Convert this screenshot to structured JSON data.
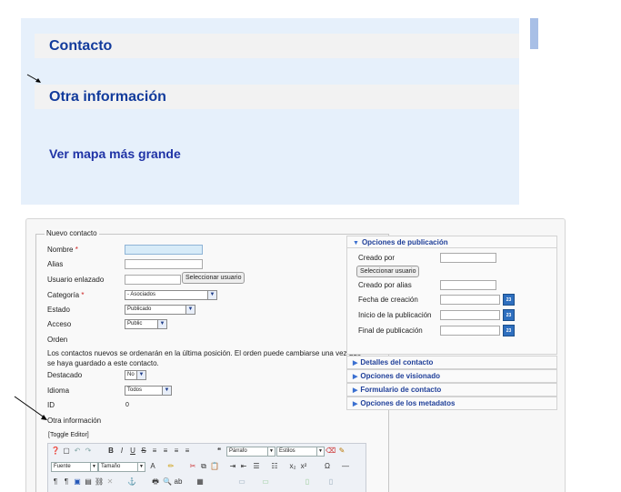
{
  "preview": {
    "contact_heading": "Contacto",
    "other_info_heading": "Otra información",
    "map_link": "Ver mapa más grande"
  },
  "form": {
    "legend": "Nuevo contacto",
    "required_mark": "*",
    "fields": {
      "nombre": "Nombre",
      "alias": "Alias",
      "usuario_enlazado": "Usuario enlazado",
      "seleccionar_usuario": "Seleccionar usuario",
      "categoria": "Categoría",
      "categoria_value": "- Asociados",
      "estado": "Estado",
      "estado_value": "Publicado",
      "acceso": "Acceso",
      "acceso_value": "Public",
      "orden": "Orden",
      "orden_note": "Los contactos nuevos se ordenarán en la última posición. El orden puede cambiarse una vez que se haya guardado a este contacto.",
      "destacado": "Destacado",
      "destacado_value": "No",
      "idioma": "Idioma",
      "idioma_value": "Todos",
      "id": "ID",
      "id_value": "0",
      "otra_informacion": "Otra información"
    },
    "editor": {
      "toggle": "[Toggle Editor]",
      "format_select": "Párrafo",
      "styles_select": "Estilos",
      "font_select": "Fuente",
      "size_select": "Tamaño"
    }
  },
  "sidebar": {
    "publishing": {
      "title": "Opciones de publicación",
      "creado_por": "Creado por",
      "seleccionar_usuario": "Seleccionar usuario",
      "creado_por_alias": "Creado por alias",
      "fecha_creacion": "Fecha de creación",
      "inicio_publicacion": "Inicio de la publicación",
      "final_publicacion": "Final de publicación",
      "calendar_label": "23"
    },
    "collapsed_panels": [
      "Detalles del contacto",
      "Opciones de visionado",
      "Formulario de contacto",
      "Opciones de los metadatos"
    ]
  },
  "colors": {
    "preview_bg": "#e6f0fb",
    "heading_blue": "#123b9c",
    "panel_title_blue": "#1f3f99",
    "name_input_highlight": "#d7ebf8"
  }
}
